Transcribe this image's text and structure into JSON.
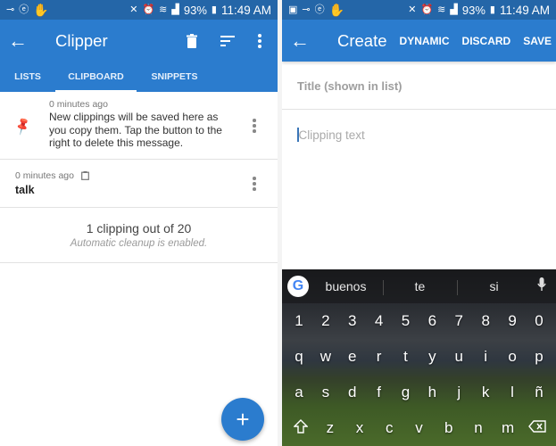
{
  "status_bar": {
    "left_panel_icons": [
      "key-icon",
      "e-circle-icon",
      "hand-icon"
    ],
    "right_panel_icons": [
      "image-icon",
      "key-icon",
      "e-circle-icon",
      "hand-icon"
    ],
    "system_icons": [
      "mute-icon",
      "alarm-icon",
      "wifi-icon",
      "signal-icon"
    ],
    "battery": "93%",
    "time": "11:49 AM"
  },
  "left": {
    "appbar": {
      "title": "Clipper",
      "actions": [
        "delete-icon",
        "sort-icon",
        "more-icon"
      ]
    },
    "tabs": [
      {
        "label": "LISTS",
        "active": false
      },
      {
        "label": "CLIPBOARD",
        "active": true
      },
      {
        "label": "SNIPPETS",
        "active": false
      }
    ],
    "items": [
      {
        "time": "0 minutes ago",
        "pinned": true,
        "text": "New clippings will be saved here as you copy them. Tap the button to the right to delete this message."
      },
      {
        "time": "0 minutes ago",
        "clipboard_icon": true,
        "text": "talk"
      }
    ],
    "summary": {
      "count": "1 clipping out of 20",
      "note": "Automatic cleanup is enabled."
    },
    "fab": "+"
  },
  "right": {
    "appbar": {
      "title": "Create",
      "actions": [
        "DYNAMIC",
        "DISCARD",
        "SAVE"
      ]
    },
    "title_placeholder": "Title (shown in list)",
    "body_placeholder": "Clipping text",
    "keyboard": {
      "suggestions": [
        "buenos",
        "te",
        "si"
      ],
      "rows": [
        [
          "1",
          "2",
          "3",
          "4",
          "5",
          "6",
          "7",
          "8",
          "9",
          "0"
        ],
        [
          "q",
          "w",
          "e",
          "r",
          "t",
          "y",
          "u",
          "i",
          "o",
          "p"
        ],
        [
          "a",
          "s",
          "d",
          "f",
          "g",
          "h",
          "j",
          "k",
          "l",
          "ñ"
        ],
        [
          "shift",
          "z",
          "x",
          "c",
          "v",
          "b",
          "n",
          "m",
          "backspace"
        ]
      ]
    }
  },
  "colors": {
    "primary": "#2b7cce",
    "status_bar": "#2466a8",
    "pin": "#d32f2f"
  }
}
